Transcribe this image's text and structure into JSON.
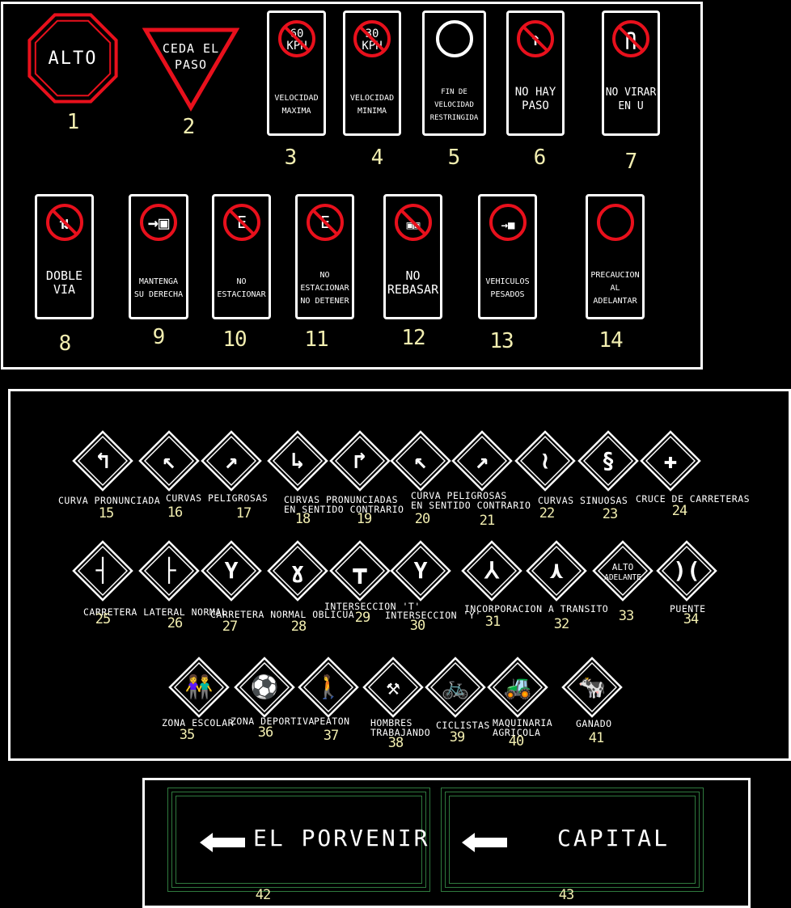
{
  "colors": {
    "sign_red": "#e8101c",
    "sign_white": "#ffffff",
    "number_yellow": "#f2eeb0",
    "guide_green": "#2f7a3e",
    "background": "#000000"
  },
  "regulatory": [
    {
      "num": "1",
      "shape": "octagon",
      "lines": [
        "ALTO"
      ]
    },
    {
      "num": "2",
      "shape": "triangle",
      "lines": [
        "CEDA EL",
        "PASO"
      ]
    },
    {
      "num": "3",
      "shape": "rect",
      "icon": "speed-limit-circle",
      "icon_text": [
        "60",
        "KPH"
      ],
      "lines": [
        "VELOCIDAD",
        "MAXIMA"
      ]
    },
    {
      "num": "4",
      "shape": "rect",
      "icon": "speed-limit-circle",
      "icon_text": [
        "30",
        "KPH"
      ],
      "lines": [
        "VELOCIDAD",
        "MINIMA"
      ]
    },
    {
      "num": "5",
      "shape": "rect",
      "icon": "end-restriction-circle",
      "icon_text": [],
      "lines": [
        "FIN DE",
        "VELOCIDAD",
        "RESTRINGIDA"
      ]
    },
    {
      "num": "6",
      "shape": "rect",
      "icon": "no-entry-arrow",
      "icon_text": [],
      "lines": [
        "NO HAY",
        "PASO"
      ]
    },
    {
      "num": "7",
      "shape": "rect",
      "icon": "no-u-turn",
      "icon_text": [],
      "lines": [
        "NO VIRAR",
        "EN U"
      ]
    },
    {
      "num": "8",
      "shape": "rect",
      "icon": "two-way-arrows",
      "icon_text": [],
      "lines": [
        "DOBLE",
        "VIA"
      ]
    },
    {
      "num": "9",
      "shape": "rect",
      "icon": "keep-right-car",
      "icon_text": [],
      "lines": [
        "MANTENGA",
        "SU DERECHA"
      ]
    },
    {
      "num": "10",
      "shape": "rect",
      "icon": "no-parking-e",
      "icon_text": [
        "E"
      ],
      "lines": [
        "NO",
        "ESTACIONAR"
      ]
    },
    {
      "num": "11",
      "shape": "rect",
      "icon": "no-stopping-e",
      "icon_text": [
        "E"
      ],
      "lines": [
        "NO",
        "ESTACIONAR",
        "NO DETENER"
      ]
    },
    {
      "num": "12",
      "shape": "rect",
      "icon": "no-overtaking-cars",
      "icon_text": [],
      "lines": [
        "NO",
        "REBASAR"
      ]
    },
    {
      "num": "13",
      "shape": "rect",
      "icon": "heavy-vehicles-truck",
      "icon_text": [],
      "lines": [
        "VEHICULOS",
        "PESADOS"
      ]
    },
    {
      "num": "14",
      "shape": "rect",
      "icon": "caution-circle",
      "icon_text": [],
      "lines": [
        "PRECAUCION",
        "AL",
        "ADELANTAR"
      ]
    }
  ],
  "warning": [
    {
      "num": "15",
      "icon": "sharp-curve-left",
      "label": [
        "CURVA PRONUNCIADA"
      ]
    },
    {
      "num": "16",
      "icon": "curve-left",
      "label": [
        "CURVAS PELIGROSAS"
      ]
    },
    {
      "num": "17",
      "icon": "curve-right",
      "label": []
    },
    {
      "num": "18",
      "icon": "reverse-sharp-curve",
      "label": [
        "CURVAS PRONUNCIADAS",
        "EN SENTIDO CONTRARIO"
      ]
    },
    {
      "num": "19",
      "icon": "reverse-sharp-curve-right",
      "label": []
    },
    {
      "num": "20",
      "icon": "reverse-curve-left",
      "label": [
        "CURVA PELIGROSAS",
        "EN SENTIDO CONTRARIO"
      ]
    },
    {
      "num": "21",
      "icon": "reverse-curve-right",
      "label": []
    },
    {
      "num": "22",
      "icon": "winding-road",
      "label": [
        "CURVAS SINUOSAS"
      ]
    },
    {
      "num": "23",
      "icon": "winding-road-2",
      "label": []
    },
    {
      "num": "24",
      "icon": "crossroads",
      "label": [
        "CRUCE DE CARRETERAS"
      ]
    },
    {
      "num": "25",
      "icon": "side-road-left",
      "label": [
        "CARRETERA LATERAL NORMAL"
      ]
    },
    {
      "num": "26",
      "icon": "side-road-right",
      "label": []
    },
    {
      "num": "27",
      "icon": "oblique-road-left",
      "label": [
        "CARRETERA NORMAL OBLICUA"
      ]
    },
    {
      "num": "28",
      "icon": "oblique-road-right",
      "label": []
    },
    {
      "num": "29",
      "icon": "t-intersection",
      "label": [
        "INTERSECCION 'T'"
      ]
    },
    {
      "num": "30",
      "icon": "y-intersection",
      "label": [
        "INTERSECCION 'Y'"
      ]
    },
    {
      "num": "31",
      "icon": "merge-left",
      "label": [
        "INCORPORACION A TRANSITO"
      ]
    },
    {
      "num": "32",
      "icon": "merge-right",
      "label": []
    },
    {
      "num": "33",
      "icon": "stop-ahead",
      "inner": [
        "ALTO",
        "ADELANTE"
      ],
      "label": []
    },
    {
      "num": "34",
      "icon": "narrow-bridge",
      "label": [
        "PUENTE"
      ]
    },
    {
      "num": "35",
      "icon": "school-children",
      "label": [
        "ZONA ESCOLAR"
      ]
    },
    {
      "num": "36",
      "icon": "sports-player",
      "label": [
        "ZONA DEPORTIVA"
      ]
    },
    {
      "num": "37",
      "icon": "pedestrian",
      "label": [
        "PEATON"
      ]
    },
    {
      "num": "38",
      "icon": "men-working",
      "label": [
        "HOMBRES",
        "TRABAJANDO"
      ]
    },
    {
      "num": "39",
      "icon": "cyclist",
      "label": [
        "CICLISTAS"
      ]
    },
    {
      "num": "40",
      "icon": "tractor",
      "label": [
        "MAQUINARIA",
        "AGRICOLA"
      ]
    },
    {
      "num": "41",
      "icon": "cattle",
      "label": [
        "GANADO"
      ]
    }
  ],
  "guide": [
    {
      "num": "42",
      "icon": "arrow-left",
      "text": "EL PORVENIR"
    },
    {
      "num": "43",
      "icon": "arrow-left",
      "text": "CAPITAL"
    }
  ]
}
